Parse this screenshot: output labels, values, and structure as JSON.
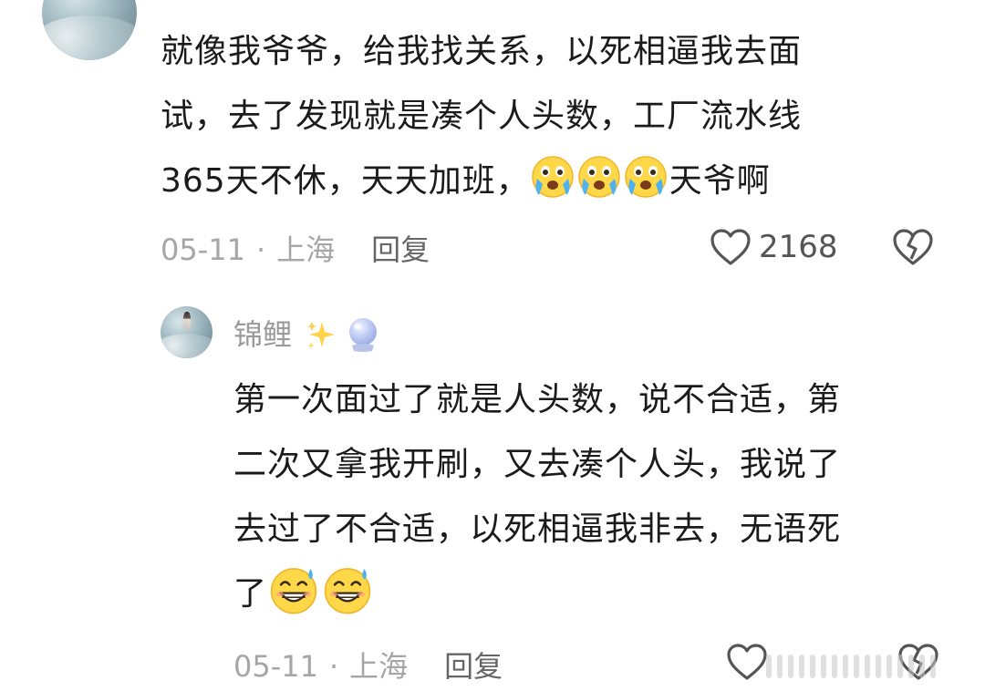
{
  "comment_1": {
    "lines": [
      "就像我爷爷，给我找关系，以死相逼我去面",
      "试，去了发现就是凑个人头数，工厂流水线",
      "365天不休，天天加班，"
    ],
    "after_emoji": "天爷啊",
    "emojis": [
      "crying-emoji",
      "crying-emoji",
      "crying-emoji"
    ],
    "date": "05-11",
    "separator": "·",
    "location": "上海",
    "reply_label": "回复",
    "like_count": "2168"
  },
  "comment_2": {
    "username": "锦鲤",
    "badges": [
      "sparkle-icon",
      "crystal-ball-icon"
    ],
    "lines": [
      "第一次面过了就是人头数，说不合适，第",
      "二次又拿我开刷，又去凑个人头，我说了",
      "去过了不合适，以死相逼我非去，无语死",
      "了"
    ],
    "emojis": [
      "sweat-smile-emoji",
      "sweat-smile-emoji"
    ],
    "date": "05-11",
    "separator": "·",
    "location": "上海",
    "reply_label": "回复"
  },
  "colors": {
    "text": "#1b1b1b",
    "meta": "#a6a6a6",
    "reply": "#666666",
    "username": "#9a9a9a"
  }
}
